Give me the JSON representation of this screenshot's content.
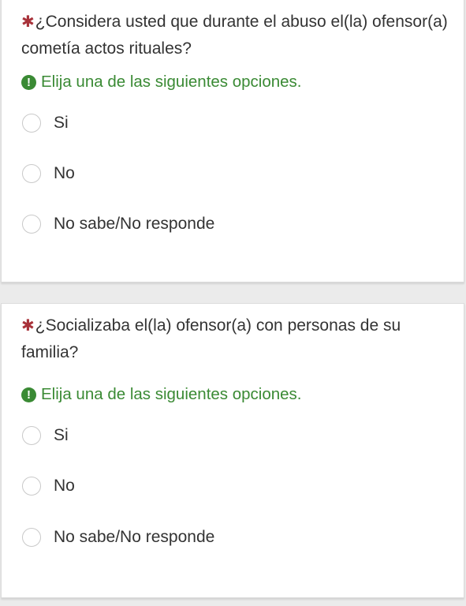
{
  "questions": [
    {
      "required_mark": "✱",
      "text": "¿Considera usted que durante el abuso el(la) ofensor(a) cometía actos rituales?",
      "hint_icon": "!",
      "hint": "Elija una de las siguientes opciones.",
      "options": [
        "Si",
        "No",
        "No sabe/No responde"
      ]
    },
    {
      "required_mark": "✱",
      "text": "¿Socializaba el(la) ofensor(a) con personas de su familia?",
      "hint_icon": "!",
      "hint": "Elija una de las siguientes opciones.",
      "options": [
        "Si",
        "No",
        "No sabe/No responde"
      ]
    }
  ],
  "colors": {
    "required": "#a8323a",
    "hint": "#3a8a34",
    "radio_border": "#c9c9c9",
    "background": "#ebebeb"
  }
}
